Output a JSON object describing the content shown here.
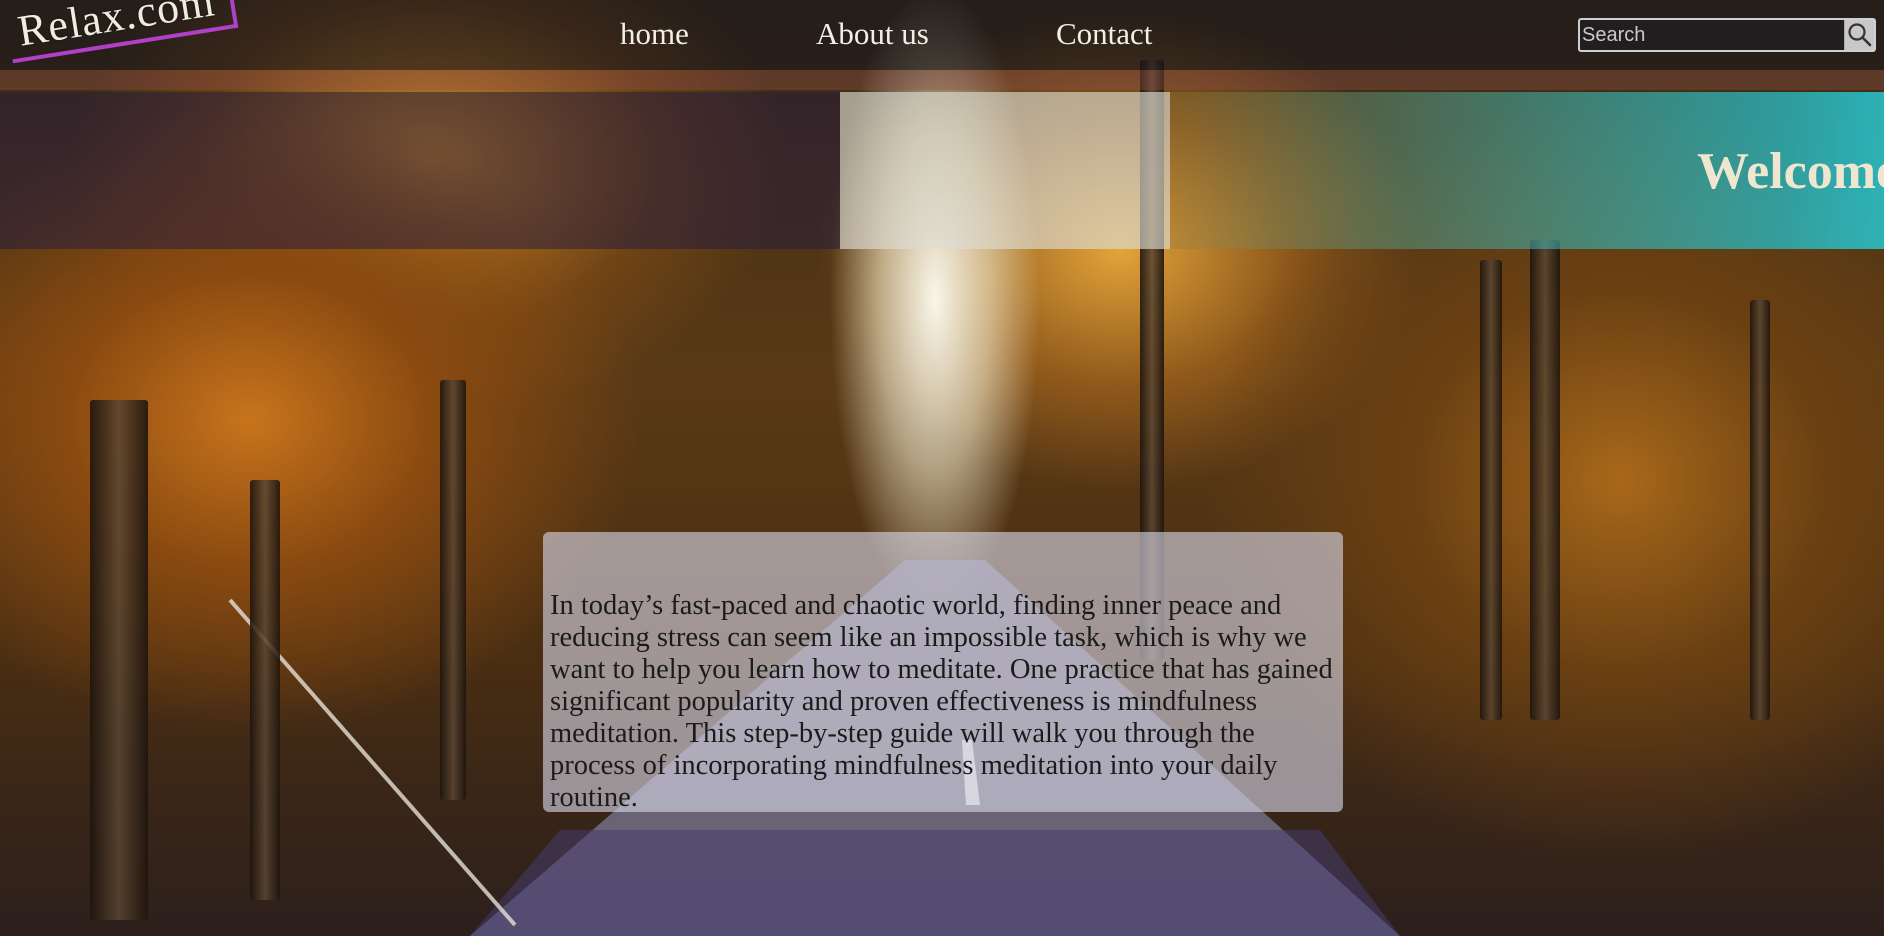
{
  "site": {
    "logo_text": "Relax.com"
  },
  "nav": {
    "items": [
      {
        "label": "home"
      },
      {
        "label": "About us"
      },
      {
        "label": "Contact"
      }
    ]
  },
  "search": {
    "placeholder": "Search",
    "value": "",
    "icon": "search-icon"
  },
  "banner": {
    "heading": "Welcome"
  },
  "intro": {
    "text": "In today’s fast-paced and chaotic world, finding inner peace and reducing stress can seem like an impossible task, which is why we want to help you learn how to meditate. One practice that has gained significant popularity and proven effectiveness is mindfulness meditation. This step-by-step guide will walk you through the process of incorporating mindfulness meditation into your daily routine."
  },
  "colors": {
    "logo_accent": "#b040c8",
    "banner_right": "#28c0cc",
    "nav_text": "#f2f0e6"
  }
}
